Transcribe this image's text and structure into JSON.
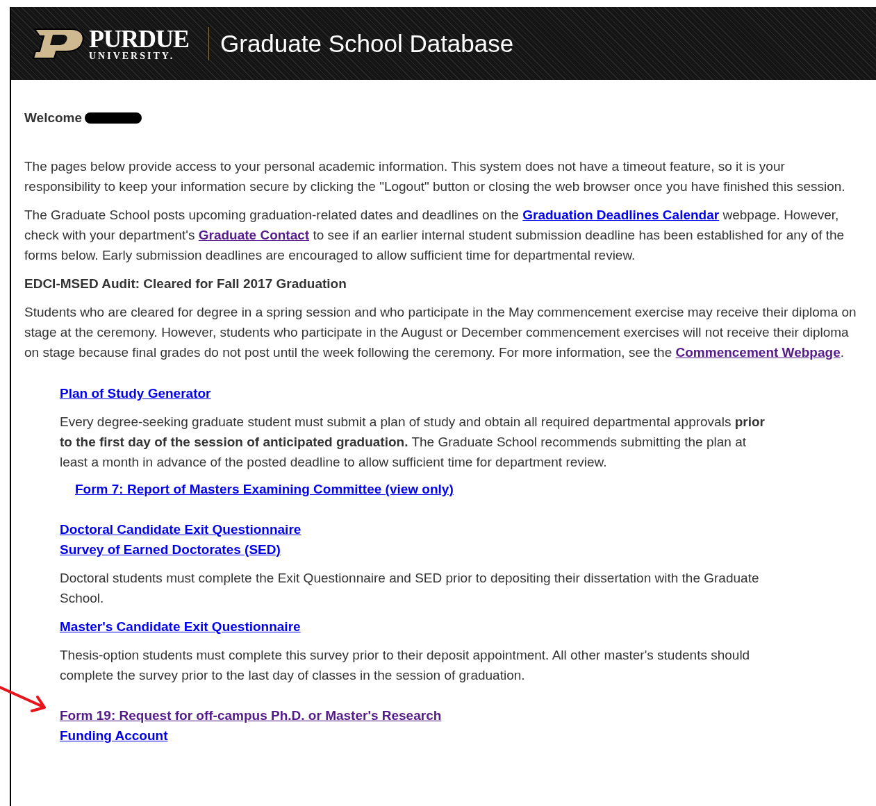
{
  "header": {
    "logo_wordmark": "PURDUE",
    "logo_subtitle": "UNIVERSITY.",
    "title": "Graduate School Database"
  },
  "welcome": {
    "label": "Welcome",
    "redacted": true
  },
  "intro": [
    [
      {
        "text": "The pages below provide access to your personal academic information. This system does not have a timeout feature, so it is your responsibility to keep your information secure by clicking the \"Logout\" button or closing the web browser once you have finished this session."
      }
    ],
    [
      {
        "text": "The Graduate School posts upcoming graduation-related dates and deadlines on the "
      },
      {
        "link": "Graduation Deadlines Calendar",
        "visited": false
      },
      {
        "text": " webpage. However, check with your department's "
      },
      {
        "link": "Graduate Contact",
        "visited": true
      },
      {
        "text": " to see if an earlier internal student submission deadline has been established for any of the forms below. Early submission deadlines are encouraged to allow sufficient time for departmental review."
      }
    ]
  ],
  "audit_status": "EDCI-MSED Audit: Cleared for Fall 2017 Graduation",
  "commencement": [
    {
      "text": "Students who are cleared for degree in a spring session and who participate in the May commencement exercise may receive their diploma on stage at the ceremony. However, students who participate in the August or December commencement exercises will not receive their diploma on stage because final grades do not post until the week following the ceremony. For more information, see the "
    },
    {
      "link": "Commencement Webpage",
      "visited": true
    },
    {
      "text": "."
    }
  ],
  "form_groups": [
    [
      {
        "kind": "link",
        "text": "Plan of Study Generator",
        "visited": false
      },
      {
        "kind": "paragraph",
        "text": "Every degree-seeking graduate student must submit a plan of study and obtain all required departmental approvals **prior to the first day of the session of anticipated graduation.** The Graduate School recommends submitting the plan at least a month in advance of the posted deadline to allow sufficient time for department review."
      },
      {
        "kind": "sublink",
        "text": "Form 7: Report of Masters Examining Committee (view only)",
        "visited": false
      }
    ],
    [
      {
        "kind": "link",
        "text": "Doctoral Candidate Exit Questionnaire",
        "visited": false
      },
      {
        "kind": "link",
        "text": "Survey of Earned Doctorates (SED)",
        "visited": false
      },
      {
        "kind": "paragraph",
        "text": "Doctoral students must complete the Exit Questionnaire and SED prior to depositing their dissertation with the Graduate School."
      },
      {
        "kind": "link",
        "text": "Master's Candidate Exit Questionnaire",
        "visited": false
      },
      {
        "kind": "paragraph",
        "text": "Thesis-option students must complete this survey prior to their deposit appointment. All other master's students should complete the survey prior to the last day of classes in the session of graduation."
      }
    ],
    [
      {
        "kind": "link",
        "text": "Form 19: Request for off-campus Ph.D. or Master's Research",
        "visited": true,
        "arrow": true
      },
      {
        "kind": "link",
        "text": "Funding Account",
        "visited": false
      }
    ]
  ]
}
